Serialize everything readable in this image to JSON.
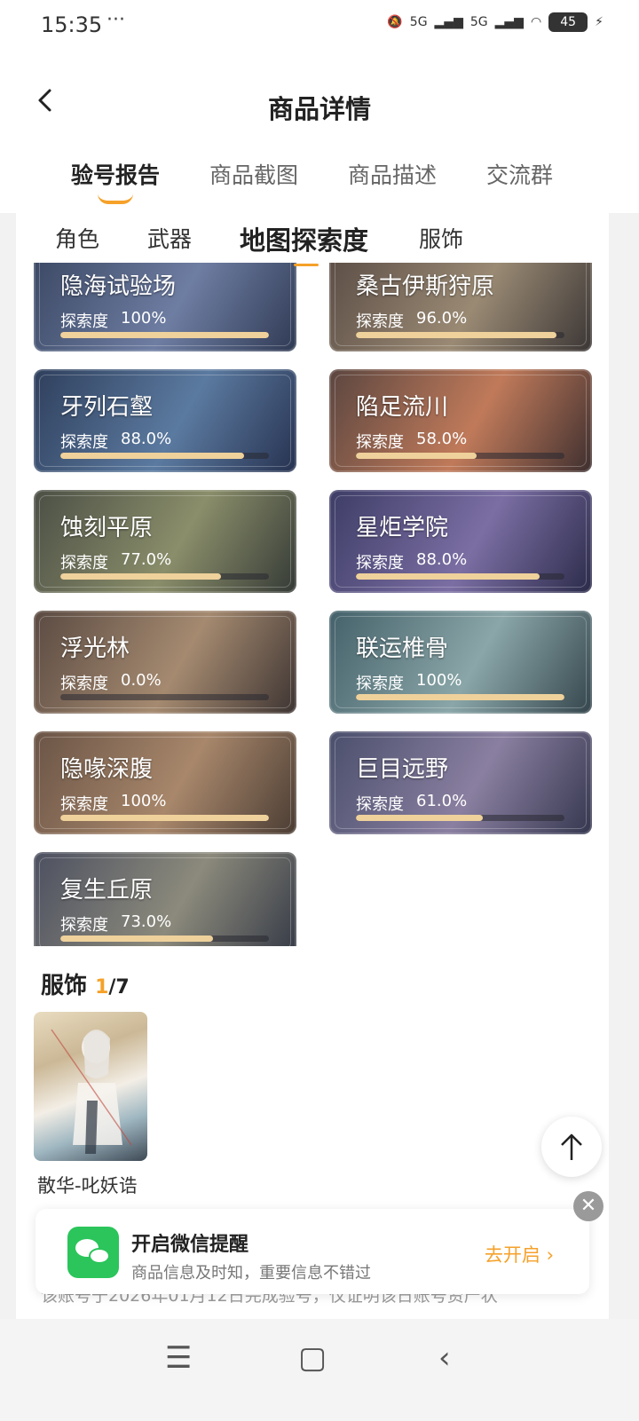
{
  "status": {
    "time": "15:35",
    "dots": "···",
    "network1": "5G",
    "network2": "5G",
    "battery": "45"
  },
  "header": {
    "title": "商品详情",
    "back_icon": "chevron-left-icon",
    "tabs": [
      {
        "label": "验号报告",
        "active": true
      },
      {
        "label": "商品截图",
        "active": false
      },
      {
        "label": "商品描述",
        "active": false
      },
      {
        "label": "交流群",
        "active": false
      }
    ]
  },
  "subtabs": [
    {
      "label": "角色",
      "active": false
    },
    {
      "label": "武器",
      "active": false
    },
    {
      "label": "地图探索度",
      "active": true
    },
    {
      "label": "服饰",
      "active": false
    }
  ],
  "maps": {
    "metric_label": "探索度",
    "items": [
      {
        "name": "隐海试验场",
        "percent_text": "100%",
        "progress": 1.0
      },
      {
        "name": "桑古伊斯狩原",
        "percent_text": "96.0%",
        "progress": 0.96
      },
      {
        "name": "牙列石壑",
        "percent_text": "88.0%",
        "progress": 0.88
      },
      {
        "name": "陷足流川",
        "percent_text": "58.0%",
        "progress": 0.58
      },
      {
        "name": "蚀刻平原",
        "percent_text": "77.0%",
        "progress": 0.77
      },
      {
        "name": "星炬学院",
        "percent_text": "88.0%",
        "progress": 0.88
      },
      {
        "name": "浮光林",
        "percent_text": "0.0%",
        "progress": 0.0
      },
      {
        "name": "联运椎骨",
        "percent_text": "100%",
        "progress": 1.0
      },
      {
        "name": "隐喙深腹",
        "percent_text": "100%",
        "progress": 1.0
      },
      {
        "name": "巨目远野",
        "percent_text": "61.0%",
        "progress": 0.61
      },
      {
        "name": "复生丘原",
        "percent_text": "73.0%",
        "progress": 0.73
      }
    ]
  },
  "costumes": {
    "title": "服饰",
    "current": "1",
    "total": "/7",
    "items": [
      {
        "name": "散华-叱妖诰"
      }
    ]
  },
  "description_partial": "该账号于2026年01月12日完成验号，仅证明该日账号资产状",
  "wechat_banner": {
    "title": "开启微信提醒",
    "subtitle": "商品信息及时知，重要信息不错过",
    "action": "去开启 ›"
  },
  "colors": {
    "accent": "#f5a12a",
    "progress_fill": "#efd19b",
    "wechat_green": "#2bc55b"
  },
  "nav": {
    "menu_icon": "☰",
    "home_icon": "▢",
    "back_icon": "‹"
  }
}
